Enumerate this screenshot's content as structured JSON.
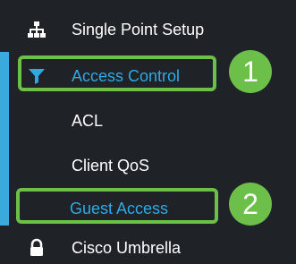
{
  "menu": {
    "items": [
      {
        "label": "Single Point Setup",
        "icon": "network-icon"
      },
      {
        "label": "Access Control",
        "icon": "filter-icon",
        "active": true
      },
      {
        "label": "ACL"
      },
      {
        "label": "Client QoS"
      },
      {
        "label": "Guest Access",
        "active": true
      },
      {
        "label": "Cisco Umbrella",
        "icon": "lock-icon"
      }
    ]
  },
  "callouts": [
    {
      "number": "1"
    },
    {
      "number": "2"
    }
  ],
  "colors": {
    "background": "#1f2327",
    "accent": "#3aa9db",
    "active_text": "#2fa9e6",
    "highlight": "#6cc04a"
  }
}
